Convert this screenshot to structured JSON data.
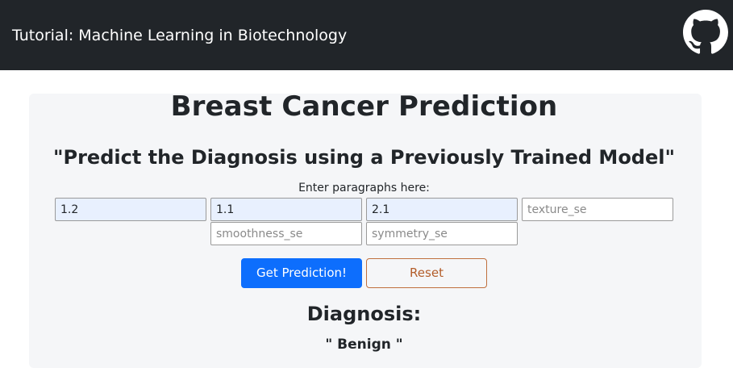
{
  "navbar": {
    "brand": "Tutorial: Machine Learning in Biotechnology",
    "github_icon": "github-icon",
    "background": "#212529"
  },
  "main": {
    "title": "Breast Cancer Prediction",
    "subtitle": "\"Predict the Diagnosis using a Previously Trained Model\"",
    "hint": "Enter paragraphs here:"
  },
  "form": {
    "fields": [
      {
        "value": "1.2",
        "placeholder": ""
      },
      {
        "value": "1.1",
        "placeholder": ""
      },
      {
        "value": "2.1",
        "placeholder": ""
      },
      {
        "value": "",
        "placeholder": "texture_se"
      },
      {
        "value": "",
        "placeholder": "smoothness_se"
      },
      {
        "value": "",
        "placeholder": "symmetry_se"
      }
    ],
    "predict_label": "Get Prediction!",
    "reset_label": "Reset"
  },
  "result": {
    "heading": "Diagnosis:",
    "value": "\" Benign \""
  },
  "colors": {
    "primary": "#0d6efd",
    "reset_border": "#c0703e",
    "autofill": "#e8f0fe"
  }
}
